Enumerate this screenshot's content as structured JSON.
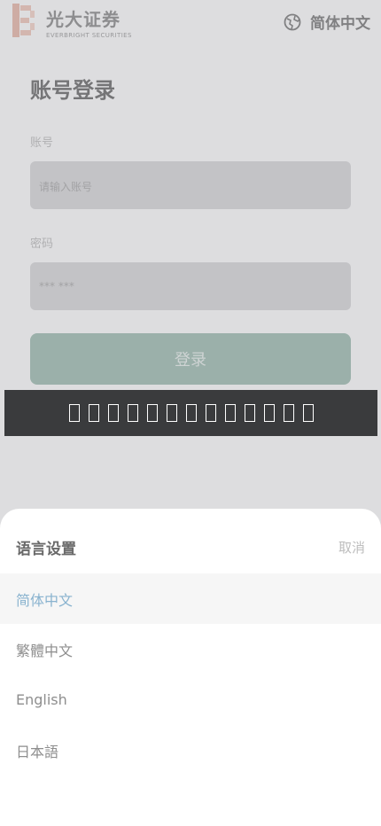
{
  "brand": {
    "name": "光大证券",
    "subtitle": "EVERBRIGHT SECURITIES"
  },
  "header": {
    "language": "简体中文"
  },
  "login": {
    "title": "账号登录",
    "account_label": "账号",
    "account_placeholder": "请输入账号",
    "password_label": "密码",
    "password_value": "*** ***",
    "submit": "登录"
  },
  "toast": {
    "missing_glyph_count": 13
  },
  "language_sheet": {
    "title": "语言设置",
    "cancel": "取消",
    "options": [
      "简体中文",
      "繁體中文",
      "English",
      "日本語"
    ],
    "selected": "简体中文"
  },
  "colors": {
    "accent": "#9ebdb1",
    "selected_text": "#89b3cf",
    "toast_bg": "#3a3b3d"
  }
}
